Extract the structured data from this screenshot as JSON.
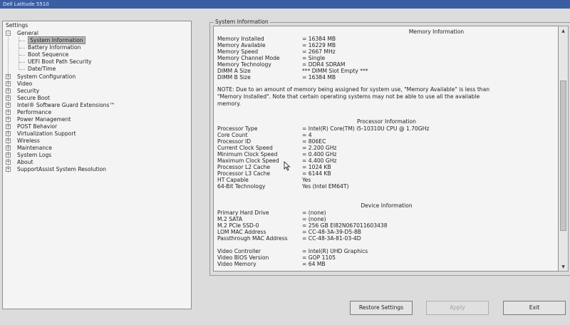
{
  "window": {
    "title": "Dell Latitude 5510"
  },
  "tree": {
    "items": [
      {
        "label": "Settings"
      },
      {
        "label": "General"
      },
      {
        "label": "System Information"
      },
      {
        "label": "Battery Information"
      },
      {
        "label": "Boot Sequence"
      },
      {
        "label": "UEFI Boot Path Security"
      },
      {
        "label": "Date/Time"
      },
      {
        "label": "System Configuration"
      },
      {
        "label": "Video"
      },
      {
        "label": "Security"
      },
      {
        "label": "Secure Boot"
      },
      {
        "label": "Intel® Software Guard Extensions™"
      },
      {
        "label": "Performance"
      },
      {
        "label": "Power Management"
      },
      {
        "label": "POST Behavior"
      },
      {
        "label": "Virtualization Support"
      },
      {
        "label": "Wireless"
      },
      {
        "label": "Maintenance"
      },
      {
        "label": "System Logs"
      },
      {
        "label": "About"
      },
      {
        "label": "SupportAssist System Resolution"
      }
    ]
  },
  "group_label": "System Information",
  "memory": {
    "title": "Memory Information",
    "rows": [
      {
        "label": "Memory Installed",
        "value": "= 16384 MB"
      },
      {
        "label": "Memory Available",
        "value": "= 16229 MB"
      },
      {
        "label": "Memory Speed",
        "value": "= 2667 MHz"
      },
      {
        "label": "Memory Channel Mode",
        "value": "= Single"
      },
      {
        "label": "Memory Technology",
        "value": "= DDR4 SDRAM"
      },
      {
        "label": "DIMM A Size",
        "value": "*** DIMM Slot Empty ***"
      },
      {
        "label": "DIMM B Size",
        "value": "= 16384 MB"
      }
    ],
    "note": "NOTE: Due to an amount of memory being assigned for system use, \"Memory Available\" is less than \"Memory Installed\". Note that certain operating systems may not be able to use all the available memory."
  },
  "processor": {
    "title": "Processor Information",
    "rows": [
      {
        "label": "Processor Type",
        "value": "= Intel(R) Core(TM) i5-10310U CPU @ 1.70GHz"
      },
      {
        "label": "Core Count",
        "value": "= 4"
      },
      {
        "label": "Processor ID",
        "value": "= 806EC"
      },
      {
        "label": "Current Clock Speed",
        "value": "= 2.200 GHz"
      },
      {
        "label": "Minimum Clock Speed",
        "value": "= 0.400 GHz"
      },
      {
        "label": "Maximum Clock Speed",
        "value": "= 4.400 GHz"
      },
      {
        "label": "Processor L2 Cache",
        "value": "= 1024 KB"
      },
      {
        "label": "Processor L3 Cache",
        "value": "= 6144 KB"
      },
      {
        "label": "HT Capable",
        "value": "Yes"
      },
      {
        "label": "64-Bit Technology",
        "value": "Yes (Intel EM64T)"
      }
    ]
  },
  "device": {
    "title": "Device Information",
    "rows": [
      {
        "label": "Primary Hard Drive",
        "value": "= (none)"
      },
      {
        "label": "M.2 SATA",
        "value": "= (none)"
      },
      {
        "label": "M.2 PCIe SSD-0",
        "value": "= 256 GB EI82N067011603438"
      },
      {
        "label": "LOM MAC Address",
        "value": "= CC-48-3A-39-D5-8B"
      },
      {
        "label": "Passthrough MAC Address",
        "value": "= CC-48-3A-81-03-4D"
      }
    ],
    "rows2": [
      {
        "label": "Video Controller",
        "value": "= Intel(R) UHD Graphics"
      },
      {
        "label": "Video BIOS Version",
        "value": "= GOP 1105"
      },
      {
        "label": "Video Memory",
        "value": "= 64 MB"
      }
    ]
  },
  "buttons": {
    "restore": "Restore Settings",
    "apply": "Apply",
    "exit": "Exit"
  },
  "icons": {
    "expand": "+",
    "collapse": "−",
    "scroll_up": "▲",
    "scroll_down": "▼"
  }
}
